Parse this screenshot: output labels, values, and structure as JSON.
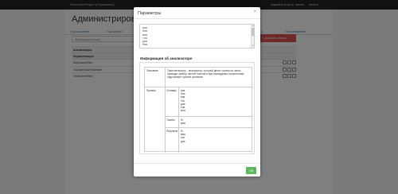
{
  "navbar": {
    "brand": "ReferentieProject (Сервисные)",
    "user": "Администратор: admin",
    "logout": "Выйти"
  },
  "page": {
    "title": "Администрирование",
    "tabs": [
      "Справочники",
      "Настройки",
      "Словари",
      "Токены",
      "Паттерны",
      "Пользователи"
    ],
    "filter_placeholder": "Фильтрация (поиск)",
    "add_button": "Добавить новую"
  },
  "rows": [
    {
      "label": "Анализаторы",
      "header": true
    },
    {
      "label": "Нормализация",
      "header": true
    },
    {
      "label": "SkipTokenFilter",
      "header": false
    },
    {
      "label": "ToLowerCaseTokenizer",
      "header": false
    },
    {
      "label": "TrimTokenFilter",
      "header": false
    }
  ],
  "modal": {
    "title": "Параметры",
    "close": "×",
    "code_lines": [
      "ана",
      "бна",
      "вна",
      "гна",
      "дна",
      "ена"
    ],
    "section_label": "Информация об анализаторе",
    "info": {
      "description_label": "Описание",
      "description_text": "Транслитератор - анализатор, который делит токены на части, проводит разбор частей токенов и при нахождении соответствия подставляет нужное значение.",
      "example_label": "Пример",
      "dictionary_label": "Словарь",
      "dictionary_values": [
        "ана",
        "бна",
        "вна",
        "гна",
        "дна",
        "ена",
        "жна"
      ],
      "tokens_label": "Токены",
      "tokens_values": [
        "бг",
        "вма"
      ],
      "result_label": "Результат",
      "result_values": [
        "бг",
        "вма",
        "гна",
        "дна"
      ]
    },
    "ok_label": "OK"
  },
  "colors": {
    "ok": "#5cb85c",
    "add": "#d9534f",
    "link": "#3a7bbf"
  }
}
